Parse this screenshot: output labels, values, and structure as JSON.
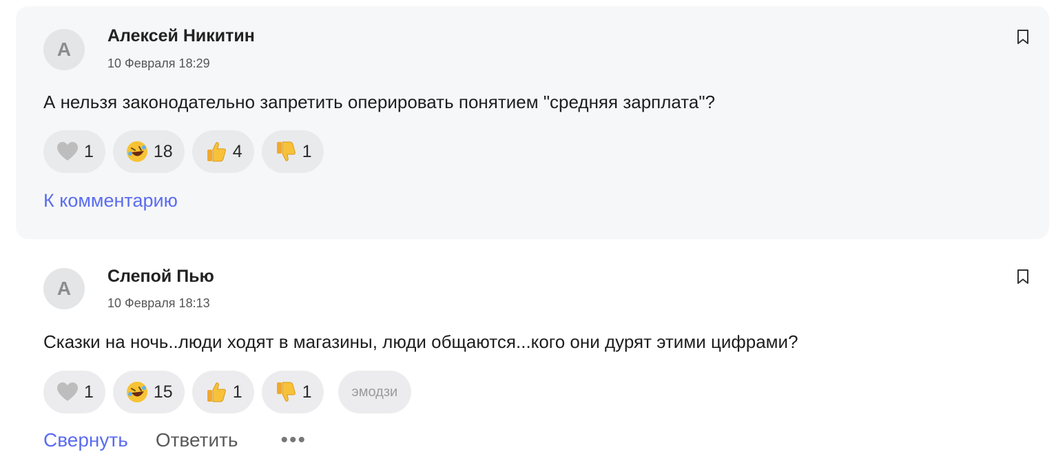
{
  "comments": [
    {
      "avatar_letter": "А",
      "author": "Алексей Никитин",
      "date": "10 Февраля 18:29",
      "text": "А нельзя законодательно запретить оперировать понятием \"средняя зарплата\"?",
      "reactions": [
        {
          "icon": "heart-icon",
          "count": "1"
        },
        {
          "icon": "rofl-face-icon",
          "count": "18"
        },
        {
          "icon": "thumbs-up-icon",
          "count": "4"
        },
        {
          "icon": "thumbs-down-icon",
          "count": "1"
        }
      ],
      "link_label": "К комментарию"
    },
    {
      "avatar_letter": "А",
      "author": "Слепой Пью",
      "date": "10 Февраля 18:13",
      "text": "Сказки на ночь..люди ходят в магазины, люди общаются...кого они дурят этими цифрами?",
      "reactions": [
        {
          "icon": "heart-icon",
          "count": "1"
        },
        {
          "icon": "rofl-face-icon",
          "count": "15"
        },
        {
          "icon": "thumbs-up-icon",
          "count": "1"
        },
        {
          "icon": "thumbs-down-icon",
          "count": "1"
        }
      ],
      "emoji_button_label": "эмодзи",
      "collapse_label": "Свернуть",
      "reply_label": "Ответить",
      "more_label": "•••"
    }
  ],
  "colors": {
    "accent": "#5a6cf0",
    "highlight_bg": "#f6f7f8",
    "pill_bg": "#ececee"
  }
}
